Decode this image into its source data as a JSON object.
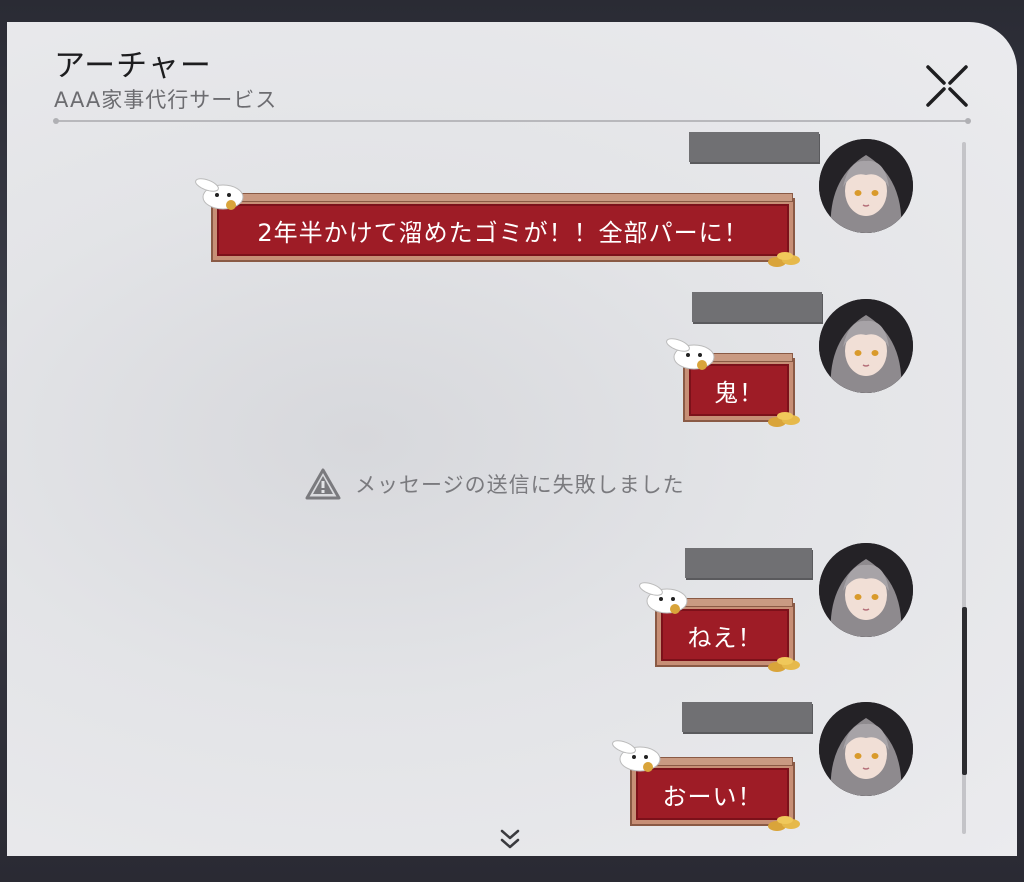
{
  "header": {
    "title": "アーチャー",
    "subtitle": "AAA家事代行サービス"
  },
  "error_message": "メッセージの送信に失敗しました",
  "messages": [
    {
      "text": "2年半かけて溜めたゴミが！！全部パーに！"
    },
    {
      "text": "鬼！"
    },
    {
      "text": "ねえ！"
    },
    {
      "text": "おーい！"
    }
  ],
  "icons": {
    "close": "close-icon",
    "warning": "warning-triangle-icon",
    "scroll_down": "double-chevron-down-icon",
    "sticker": "white-bunny-sticker",
    "avatar": "silver-haired-character-avatar"
  },
  "colors": {
    "bubble": "#9e1c26",
    "bubble_border": "#c78f76",
    "panel": "#e6e6e9"
  }
}
